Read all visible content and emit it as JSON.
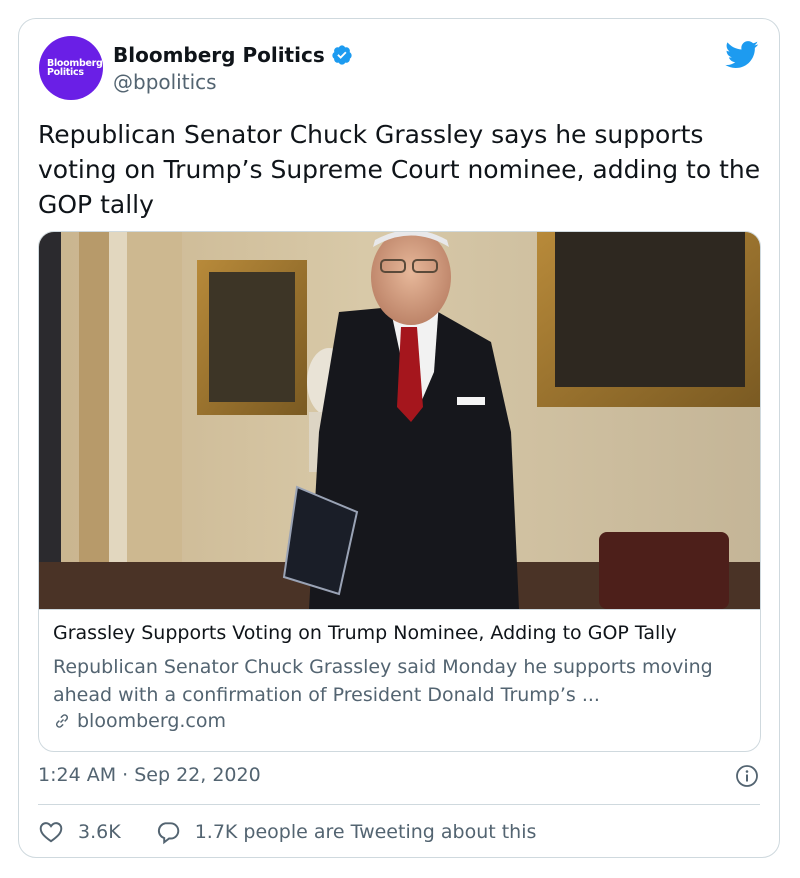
{
  "account": {
    "avatar_text_line1": "Bloomberg",
    "avatar_text_line2": "Politics",
    "name": "Bloomberg Politics",
    "handle": "@bpolitics"
  },
  "tweet": {
    "text": "Republican Senator Chuck Grassley says he supports voting on Trump’s Supreme Court nominee, adding to the GOP tally",
    "timestamp": "1:24 AM · Sep 22, 2020"
  },
  "link_card": {
    "title": "Grassley Supports Voting on Trump Nominee, Adding to GOP Tally",
    "description": "Republican Senator Chuck Grassley said Monday he supports moving ahead with a confirmation of President Donald Trump’s ...",
    "domain": "bloomberg.com"
  },
  "actions": {
    "likes": "3.6K",
    "replies_text": "1.7K people are Tweeting about this"
  },
  "colors": {
    "brand_blue": "#1d9bf0",
    "avatar_purple": "#6a1fe6",
    "muted": "#536471",
    "border": "#cfd9de"
  },
  "icons": [
    "verified-badge-icon",
    "twitter-bird-icon",
    "link-icon",
    "info-icon",
    "heart-icon",
    "reply-icon"
  ]
}
